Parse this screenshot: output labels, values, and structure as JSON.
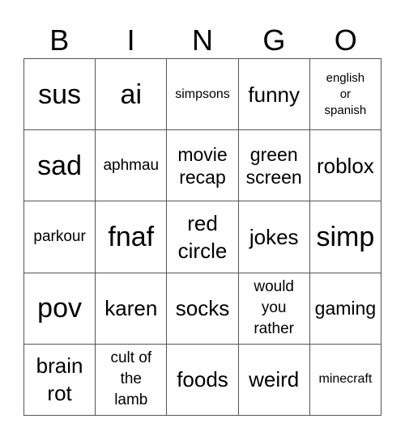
{
  "header": [
    "B",
    "I",
    "N",
    "G",
    "O"
  ],
  "cells": [
    {
      "text": "sus",
      "size": "s36"
    },
    {
      "text": "ai",
      "size": "s36"
    },
    {
      "text": "simpsons",
      "size": "s16"
    },
    {
      "text": "funny",
      "size": "s28"
    },
    {
      "text": "english\nor\nspanish",
      "size": "s15"
    },
    {
      "text": "sad",
      "size": "s36"
    },
    {
      "text": "aphmau",
      "size": "s19"
    },
    {
      "text": "movie\nrecap",
      "size": "s24"
    },
    {
      "text": "green\nscreen",
      "size": "s24"
    },
    {
      "text": "roblox",
      "size": "s28"
    },
    {
      "text": "parkour",
      "size": "s19"
    },
    {
      "text": "fnaf",
      "size": "s36"
    },
    {
      "text": "red\ncircle",
      "size": "s28"
    },
    {
      "text": "jokes",
      "size": "s28"
    },
    {
      "text": "simp",
      "size": "s36"
    },
    {
      "text": "pov",
      "size": "s36"
    },
    {
      "text": "karen",
      "size": "s28"
    },
    {
      "text": "socks",
      "size": "s28"
    },
    {
      "text": "would\nyou\nrather",
      "size": "s19"
    },
    {
      "text": "gaming",
      "size": "s24"
    },
    {
      "text": "brain\nrot",
      "size": "s28"
    },
    {
      "text": "cult of\nthe\nlamb",
      "size": "s19"
    },
    {
      "text": "foods",
      "size": "s28"
    },
    {
      "text": "weird",
      "size": "s28"
    },
    {
      "text": "minecraft",
      "size": "s16"
    }
  ]
}
